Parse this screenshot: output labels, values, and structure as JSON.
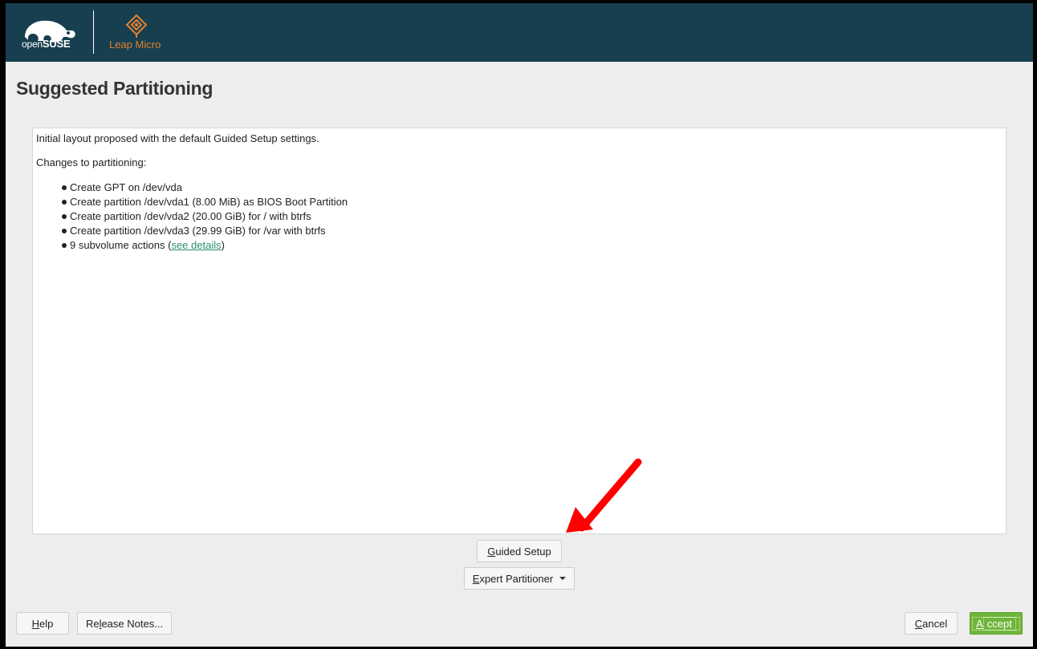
{
  "header": {
    "logo_text_light": "open",
    "logo_text_bold": "SUSE",
    "product_label": "Leap Micro",
    "colors": {
      "background": "#173f4f",
      "product_accent": "#e5802f"
    }
  },
  "page": {
    "title": "Suggested Partitioning"
  },
  "proposal": {
    "intro": "Initial layout proposed with the default Guided Setup settings.",
    "changes_heading": "Changes to partitioning:",
    "items": [
      "Create GPT on /dev/vda",
      "Create partition /dev/vda1 (8.00 MiB) as BIOS Boot Partition",
      "Create partition /dev/vda2 (20.00 GiB) for / with btrfs",
      "Create partition /dev/vda3 (29.99 GiB) for /var with btrfs"
    ],
    "subvolume_prefix": "9 subvolume actions (",
    "subvolume_link": "see details",
    "subvolume_suffix": ")"
  },
  "actions": {
    "guided_setup_mnemonic": "G",
    "guided_setup_rest": "uided Setup",
    "expert_partitioner_mnemonic": "E",
    "expert_partitioner_rest": "xpert Partitioner"
  },
  "footer": {
    "help_mnemonic": "H",
    "help_rest": "elp",
    "release_pre": "Re",
    "release_mnemonic": "l",
    "release_rest": "ease Notes...",
    "cancel_mnemonic": "C",
    "cancel_rest": "ancel",
    "accept_mnemonic": "A",
    "accept_rest": "ccept",
    "colors": {
      "accept": "#6fb53a"
    }
  },
  "annotation": {
    "arrow_color": "#ff0000"
  }
}
